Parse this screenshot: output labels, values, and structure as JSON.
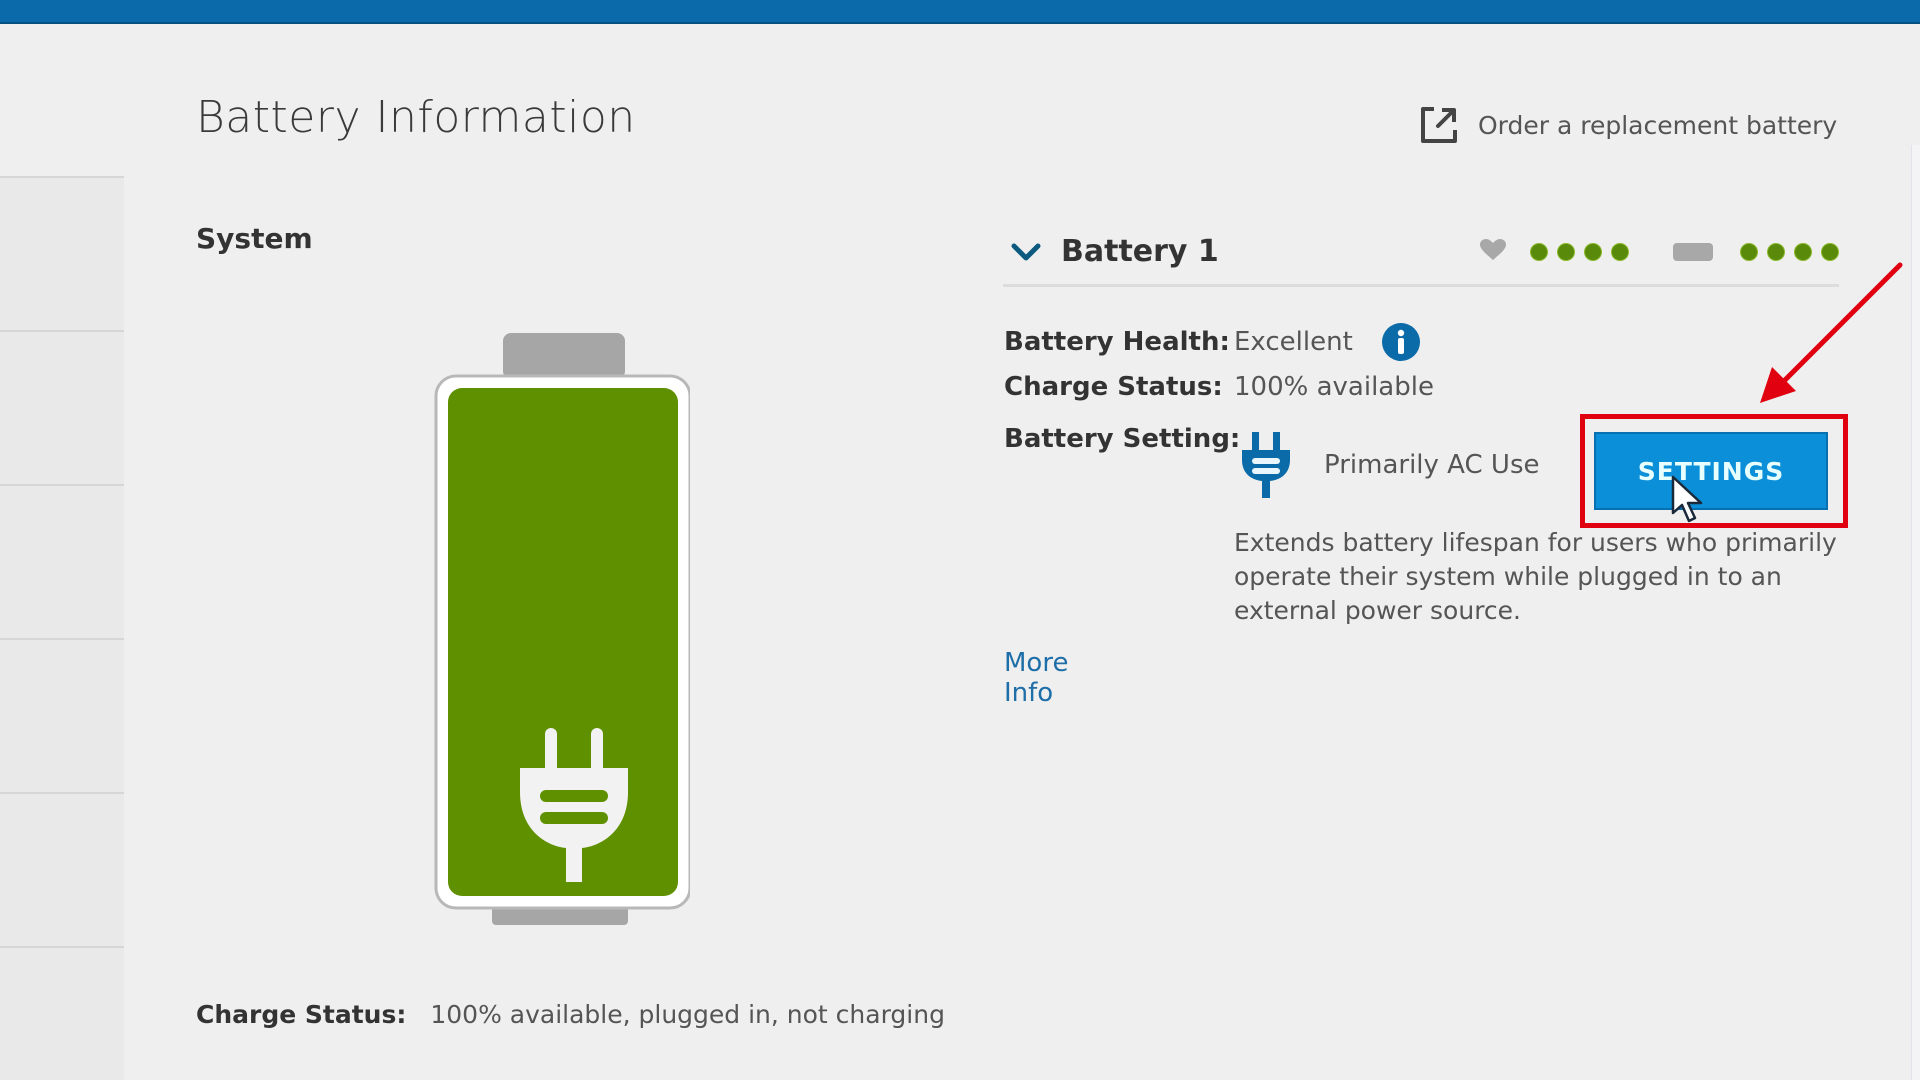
{
  "header": {
    "title": "Battery Information",
    "order_link": {
      "label": "Order a replacement battery",
      "icon": "external-link-icon"
    }
  },
  "system": {
    "title": "System",
    "battery_graphic": {
      "charge_percent": 100,
      "icon": "plug-icon",
      "fill_color": "#5f9000"
    },
    "charge_status": {
      "label": "Charge Status:",
      "value": "100% available, plugged in, not charging"
    }
  },
  "battery": {
    "name": "Battery 1",
    "expanded": true,
    "indicators": {
      "health": {
        "icon": "heart-icon",
        "level": 4,
        "max": 4
      },
      "charge": {
        "icon": "battery-icon",
        "level": 4,
        "max": 4
      },
      "color": "#5a8a0a"
    },
    "health": {
      "label": "Battery Health:",
      "value": "Excellent",
      "icon": "info-icon"
    },
    "charge_status": {
      "label": "Charge Status:",
      "value": "100% available"
    },
    "setting": {
      "label": "Battery Setting:",
      "value": "Primarily AC Use",
      "icon": "plug-icon",
      "description": "Extends battery lifespan for users who primarily operate their system while plugged in to an external power source.",
      "button_label": "SETTINGS"
    },
    "more_info": "More Info"
  },
  "annotation": {
    "highlight_color": "#e00010",
    "target": "settings-button"
  },
  "colors": {
    "accent_blue": "#0a8fd8",
    "topbar": "#0a6aaa",
    "link": "#1e6ea8"
  }
}
